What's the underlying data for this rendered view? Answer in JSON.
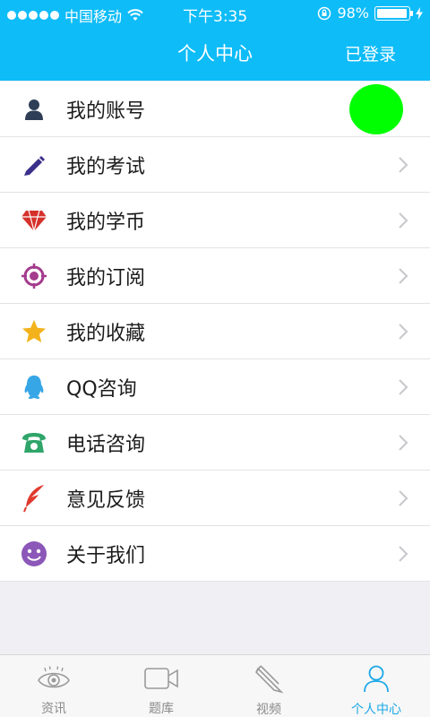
{
  "status_bar": {
    "carrier": "中国移动",
    "time": "下午3:35",
    "battery": "98%",
    "battery_level": 0.98
  },
  "nav": {
    "title": "个人中心",
    "right_label": "已登录"
  },
  "menu": {
    "items": [
      {
        "label": "我的账号",
        "icon": "user-icon",
        "color": "#2f3e57"
      },
      {
        "label": "我的考试",
        "icon": "pencil-icon",
        "color": "#3a2f8a"
      },
      {
        "label": "我的学币",
        "icon": "diamond-icon",
        "color": "#d6322c"
      },
      {
        "label": "我的订阅",
        "icon": "target-icon",
        "color": "#a43b8d"
      },
      {
        "label": "我的收藏",
        "icon": "star-icon",
        "color": "#f3b21b"
      },
      {
        "label": "QQ咨询",
        "icon": "qq-icon",
        "color": "#37a6e6"
      },
      {
        "label": "电话咨询",
        "icon": "phone-icon",
        "color": "#2fa56a"
      },
      {
        "label": "意见反馈",
        "icon": "feather-icon",
        "color": "#e03a2e"
      },
      {
        "label": "关于我们",
        "icon": "smile-icon",
        "color": "#8b57b8"
      }
    ]
  },
  "tabbar": {
    "tabs": [
      {
        "label": "资讯",
        "icon": "eye-icon"
      },
      {
        "label": "题库",
        "icon": "camera-icon"
      },
      {
        "label": "视频",
        "icon": "pencil-tab-icon"
      },
      {
        "label": "个人中心",
        "icon": "person-icon"
      }
    ],
    "active_index": 3,
    "active_color": "#1aa8e8",
    "inactive_color": "#8a8a8a"
  },
  "colors": {
    "header": "#0ebcf8",
    "avatar": "#00ff00",
    "background": "#efeff4"
  }
}
